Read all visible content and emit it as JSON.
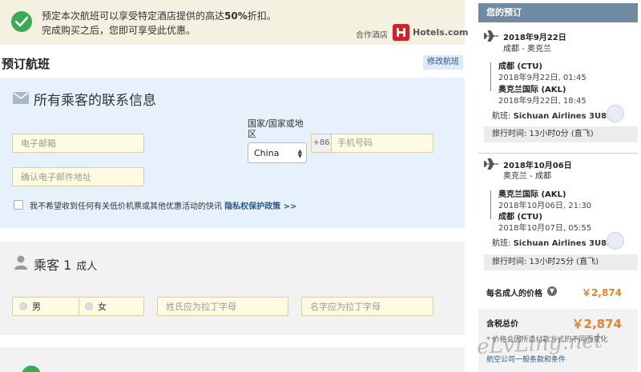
{
  "promo": {
    "line1_before": "预定本次航班可以享受特定酒店提供的高达",
    "line1_pct": "50%",
    "line1_after": "折扣。",
    "line2": "完成购买之后，您即可享受此优惠。",
    "partner_label": "合作酒店",
    "partner_name": "Hotels.com"
  },
  "booking": {
    "title": "预订航班",
    "change_label": "修改航班"
  },
  "contact": {
    "heading": "所有乘客的联系信息",
    "email_placeholder": "电子邮箱",
    "confirm_placeholder": "确认电子邮件地址",
    "country_label": "国家/国家或地区",
    "country_value": "China",
    "phone_code": "+86",
    "phone_placeholder": "手机号码",
    "optout_text": "我不希望收到任何有关低价机票或其他优惠活动的快讯",
    "privacy_link": "隐私权保护政策 >>"
  },
  "passenger": {
    "title": "乘客 1",
    "type": "成人",
    "male_label": "男",
    "female_label": "女",
    "surname_placeholder": "姓氏应为拉丁字母",
    "given_placeholder": "名字应为拉丁字母"
  },
  "itinerary": {
    "header": "您的预订",
    "outbound": {
      "date": "2018年9月22日",
      "route": "成都 - 奥克兰",
      "dep_airport": "成都 (CTU)",
      "dep_time": "2018年9月22日, 01:45",
      "arr_airport": "奥克兰国际 (AKL)",
      "arr_time": "2018年9月22日, 18:45",
      "flight_label": "航班:",
      "flight_value": "Sichuan Airlines 3U8909",
      "duration": "旅行时间: 13小时0分 (直飞)"
    },
    "return": {
      "date": "2018年10月06日",
      "route": "奥克兰 - 成都",
      "dep_airport": "奥克兰国际 (AKL)",
      "dep_time": "2018年10月06日, 21:30",
      "arr_airport": "成都 (CTU)",
      "arr_time": "2018年10月07日, 05:55",
      "flight_label": "航班:",
      "flight_value": "Sichuan Airlines 3U8910",
      "duration": "旅行时间: 13小时25分 (直飞)"
    },
    "adult_price_label": "每名成人的价格",
    "adult_price": "￥2,874",
    "total_label": "含税总价",
    "total_price": "￥2,874",
    "note": "* 价格会因所选付款方式的不同而变化",
    "terms_link": "航空公司一般条款和条件"
  },
  "watermark": "eLvLing.net",
  "colors": {
    "accent_price": "#e8822a",
    "panel_header": "#6f8aa3",
    "success": "#3caa55",
    "contact_bg": "#e6f1fb",
    "input_bg": "#fffbe3"
  }
}
